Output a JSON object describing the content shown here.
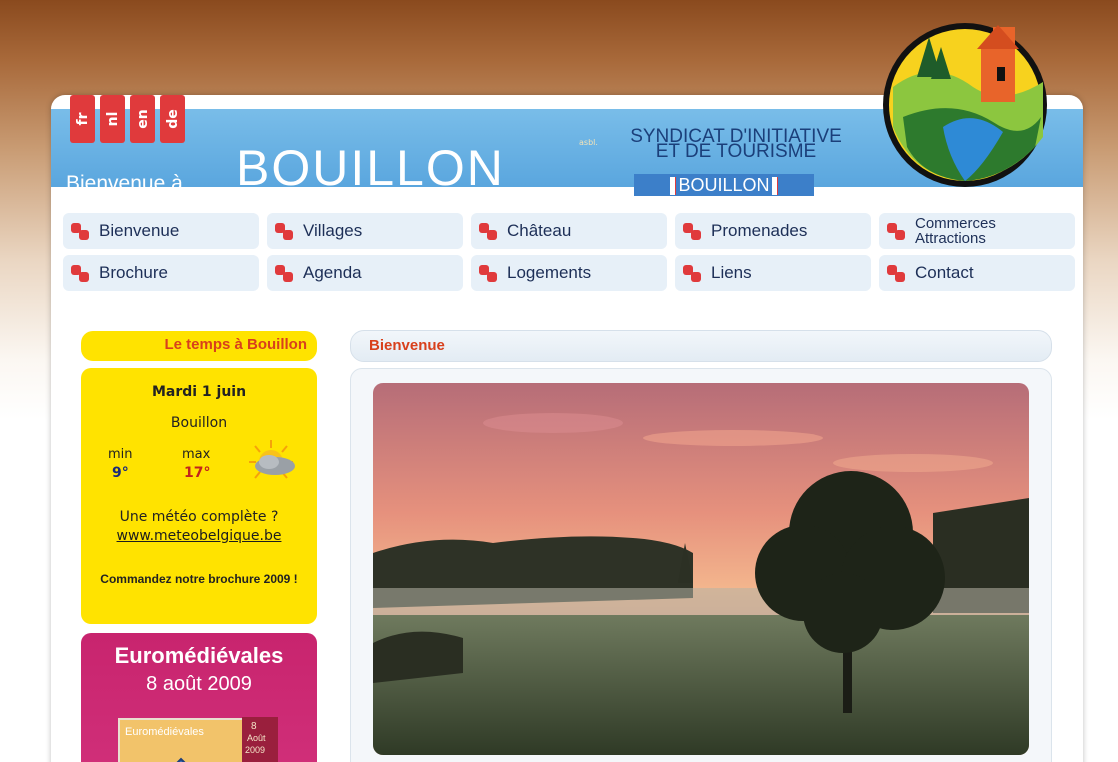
{
  "languages": [
    "fr",
    "nl",
    "en",
    "de"
  ],
  "header": {
    "welcome": "Bienvenue à",
    "town": "BOUILLON",
    "asbl": "asbl.",
    "syndicat_line1": "SYNDICAT D'INITIATIVE",
    "syndicat_line2": "ET DE TOURISME",
    "syndicat_town": "BOUILLON"
  },
  "nav": {
    "row1": [
      "Bienvenue",
      "Villages",
      "Château",
      "Promenades"
    ],
    "row1_last": [
      "Commerces",
      "Attractions"
    ],
    "row2": [
      "Brochure",
      "Agenda",
      "Logements",
      "Liens",
      "Contact"
    ]
  },
  "weather": {
    "title": "Le temps à Bouillon",
    "day": "Mardi 1 juin",
    "city": "Bouillon",
    "min_label": "min",
    "max_label": "max",
    "min_value": "9°",
    "max_value": "17°",
    "icon": "sun-cloud-icon",
    "question": "Une météo complète ?",
    "link": "www.meteobelgique.be",
    "brochure": "Commandez notre brochure 2009 !"
  },
  "promo": {
    "title": "Euromédiévales",
    "date": "8 août 2009",
    "book_title": "Euromédiévales",
    "book_date_1": "8",
    "book_date_2": "Août",
    "book_date_3": "2009"
  },
  "main": {
    "section_title": "Bienvenue"
  },
  "colors": {
    "accent_red": "#e03a3c",
    "header_blue": "#5aa6de",
    "weather_yellow": "#ffe300",
    "promo_pink": "#c8246e"
  }
}
